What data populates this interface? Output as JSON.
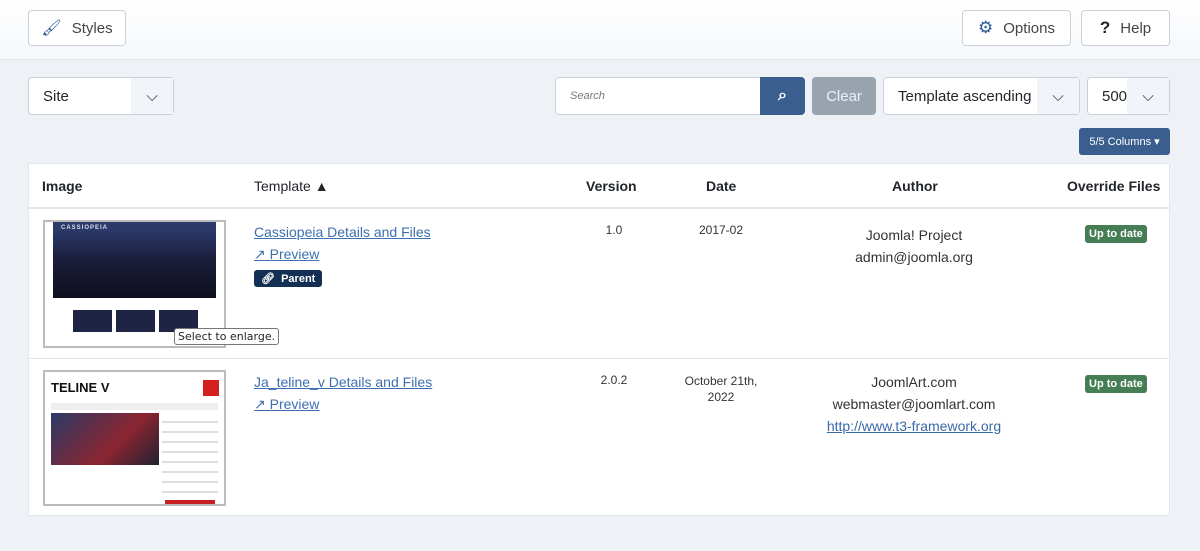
{
  "toolbar": {
    "styles": "Styles",
    "options": "Options",
    "help": "Help"
  },
  "filters": {
    "client": "Site",
    "search_placeholder": "Search",
    "clear": "Clear",
    "ordering": "Template ascending",
    "limit": "500",
    "columns": "5/5 Columns"
  },
  "table": {
    "headers": {
      "image": "Image",
      "template": "Template",
      "version": "Version",
      "date": "Date",
      "author": "Author",
      "override": "Override Files"
    },
    "rows": [
      {
        "thumb_logo": "CASSIOPEIA",
        "name": "Cassiopeia Details and Files",
        "preview": "Preview",
        "parent": "Parent",
        "version": "1.0",
        "date": "2017-02",
        "author": "Joomla! Project",
        "email": "admin@joomla.org",
        "status": "Up to date",
        "tooltip": "Select to enlarge."
      },
      {
        "thumb_logo": "TELINE V",
        "name": "Ja_teline_v Details and Files",
        "preview": "Preview",
        "version": "2.0.2",
        "date": "October 21th, 2022",
        "author": "JoomlArt.com",
        "email": "webmaster@joomlart.com",
        "url": "http://www.t3-framework.org",
        "status": "Up to date"
      }
    ]
  },
  "colors": {
    "primary": "#3a5f8f",
    "badge": "#457d54",
    "parent": "#132f53",
    "clear": "#98a3ae"
  }
}
